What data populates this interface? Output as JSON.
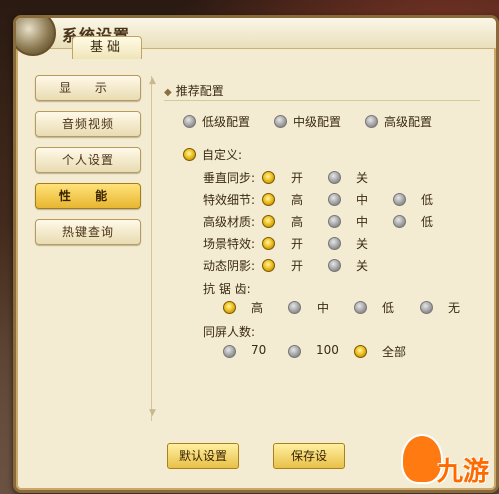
{
  "window": {
    "title": "系统设置",
    "tab": "基础"
  },
  "nav": [
    {
      "label": "显 示"
    },
    {
      "label": "音频视频"
    },
    {
      "label": "个人设置"
    },
    {
      "label": "性 能",
      "active": true
    },
    {
      "label": "热键查询"
    }
  ],
  "section": {
    "title": "推荐配置"
  },
  "presets": [
    "低级配置",
    "中级配置",
    "高级配置"
  ],
  "custom": {
    "label": "自定义:",
    "vsync": {
      "label": "垂直同步:",
      "options": [
        "开",
        "关"
      ],
      "selected": "开"
    },
    "effects": {
      "label": "特效细节:",
      "options": [
        "高",
        "中",
        "低"
      ],
      "selected": "高"
    },
    "material": {
      "label": "高级材质:",
      "options": [
        "高",
        "中",
        "低"
      ],
      "selected": "高"
    },
    "scene": {
      "label": "场景特效:",
      "options": [
        "开",
        "关"
      ],
      "selected": "开"
    },
    "shadow": {
      "label": "动态阴影:",
      "options": [
        "开",
        "关"
      ],
      "selected": "开"
    },
    "aa": {
      "label": "抗 锯 齿:",
      "options": [
        "高",
        "中",
        "低",
        "无"
      ],
      "selected": "高"
    },
    "players": {
      "label": "同屏人数:",
      "options": [
        "70",
        "100",
        "全部"
      ],
      "selected": "全部"
    }
  },
  "buttons": {
    "default": "默认设置",
    "save": "保存设"
  },
  "watermark": {
    "text": "九游"
  },
  "colors": {
    "accent": "#e8b630",
    "panel": "#f3ecd3",
    "border": "#8a6a3a"
  }
}
